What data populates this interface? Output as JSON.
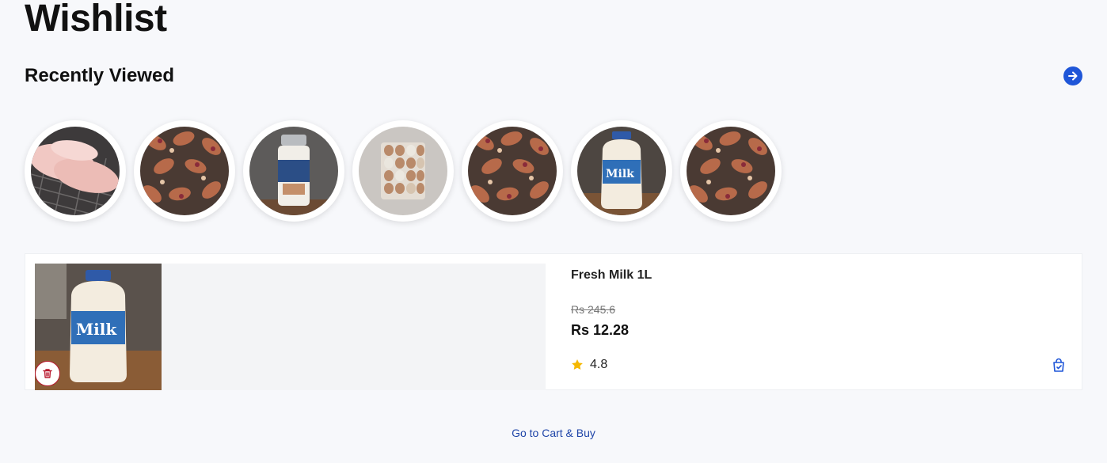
{
  "page": {
    "title": "Wishlist"
  },
  "recently_viewed": {
    "title": "Recently Viewed",
    "items": [
      {
        "image": "chicken-breast-image"
      },
      {
        "image": "chicken-drumsticks-image"
      },
      {
        "image": "cream-bottle-image"
      },
      {
        "image": "eggs-tray-image"
      },
      {
        "image": "chicken-drumsticks-image"
      },
      {
        "image": "milk-jug-image"
      },
      {
        "image": "chicken-drumsticks-image"
      }
    ]
  },
  "wishlist_item": {
    "name": "Fresh Milk 1L",
    "original_price": "Rs 245.6",
    "price": "Rs 12.28",
    "rating": "4.8"
  },
  "footer": {
    "cta_label": "Go to Cart & Buy"
  },
  "colors": {
    "accent": "#1f56d8",
    "danger": "#b8182d",
    "star": "#f5b800",
    "link": "#1f45a8"
  }
}
